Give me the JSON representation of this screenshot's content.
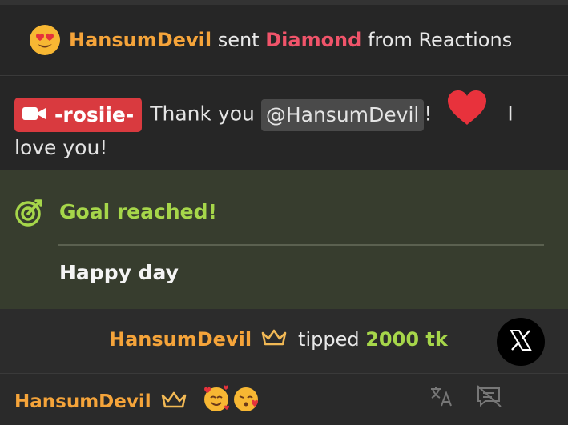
{
  "reaction": {
    "user": "HansumDevil",
    "verb": "sent",
    "item": "Diamond",
    "suffix": "from Reactions",
    "emoji": "heart-eyes-emoji"
  },
  "message": {
    "badge_name": "-rosiie-",
    "text_before": "Thank you",
    "mention": "@HansumDevil",
    "after_mention": "!",
    "text_after_heart": "I love you!"
  },
  "goal": {
    "title": "Goal reached!",
    "description": "Happy day"
  },
  "tip": {
    "user": "HansumDevil",
    "verb": "tipped",
    "amount": "2000 tk"
  },
  "compose": {
    "user": "HansumDevil",
    "emojis": [
      "smiling-face-with-hearts",
      "face-blowing-kiss"
    ]
  },
  "colors": {
    "username": "#f5a43a",
    "highlight_red": "#f0546a",
    "goal_green": "#a6d64a",
    "goal_bg": "#373d2e",
    "badge_red": "#d93a3f"
  }
}
